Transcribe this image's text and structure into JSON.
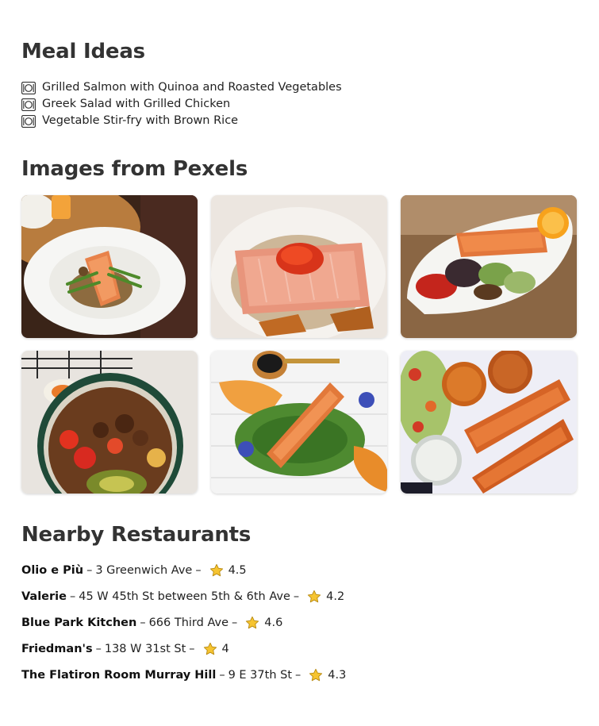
{
  "meal_ideas": {
    "heading": "Meal Ideas",
    "items": [
      {
        "icon": "plate-cutlery-icon",
        "text": "Grilled Salmon with Quinoa and Roasted Vegetables"
      },
      {
        "icon": "plate-cutlery-icon",
        "text": "Greek Salad with Grilled Chicken"
      },
      {
        "icon": "plate-cutlery-icon",
        "text": "Vegetable Stir-fry with Brown Rice"
      }
    ]
  },
  "images": {
    "heading": "Images from Pexels"
  },
  "restaurants": {
    "heading": "Nearby Restaurants",
    "separator": "–",
    "star_icon": "star-icon",
    "items": [
      {
        "name": "Olio e Più",
        "address": "3 Greenwich Ave",
        "rating": "4.5"
      },
      {
        "name": "Valerie",
        "address": "45 W 45th St between 5th & 6th Ave",
        "rating": "4.2"
      },
      {
        "name": "Blue Park Kitchen",
        "address": "666 Third Ave",
        "rating": "4.6"
      },
      {
        "name": "Friedman's",
        "address": "138 W 31st St",
        "rating": "4"
      },
      {
        "name": "The Flatiron Room Murray Hill",
        "address": "9 E 37th St",
        "rating": "4.3"
      }
    ]
  },
  "colors": {
    "heading": "#333333",
    "text": "#222222",
    "star": "#f6c431"
  }
}
